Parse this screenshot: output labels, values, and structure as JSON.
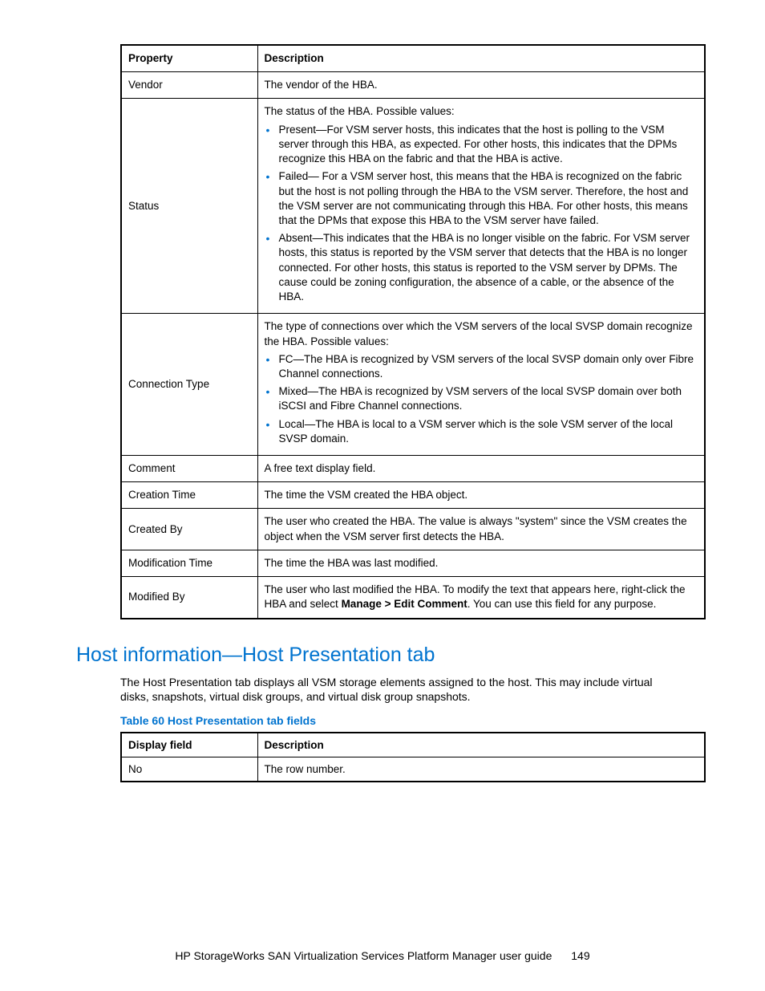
{
  "table1": {
    "headers": [
      "Property",
      "Description"
    ],
    "rows": [
      {
        "prop": "Vendor",
        "desc": "The vendor of the HBA."
      },
      {
        "prop": "Status",
        "intro": "The status of the HBA. Possible values:",
        "bullets": [
          "Present—For VSM server hosts, this indicates that the host is polling to the VSM server through this HBA, as expected. For other hosts, this indicates that the DPMs recognize this HBA on the fabric and that the HBA is active.",
          "Failed— For a VSM server host, this means that the HBA is recognized on the fabric but the host is not polling through the HBA to the VSM server. Therefore, the host and the VSM server are not communicating through this HBA. For other hosts, this means that the DPMs that expose this HBA to the VSM server have failed.",
          "Absent—This indicates that the HBA is no longer visible on the fabric. For VSM server hosts, this status is reported by the VSM server that detects that the HBA is no longer connected. For other hosts, this status is reported to the VSM server by DPMs. The cause could be zoning configuration, the absence of a cable, or the absence of the HBA."
        ]
      },
      {
        "prop": "Connection Type",
        "intro": "The type of connections over which the VSM servers of the local SVSP domain recognize the HBA. Possible values:",
        "bullets": [
          "FC—The HBA is recognized by VSM servers of the local SVSP domain only over Fibre Channel connections.",
          "Mixed—The HBA is recognized by VSM servers of the local SVSP domain over both iSCSI and Fibre Channel connections.",
          "Local—The HBA is local to a VSM server which is the sole VSM server of the local SVSP domain."
        ]
      },
      {
        "prop": "Comment",
        "desc": "A free text display field."
      },
      {
        "prop": "Creation Time",
        "desc": "The time the VSM created the HBA object."
      },
      {
        "prop": "Created By",
        "desc": "The user who created the HBA. The value is always \"system\" since the VSM creates the object when the VSM server first detects the HBA."
      },
      {
        "prop": "Modification Time",
        "desc": "The time the HBA was last modified."
      },
      {
        "prop": "Modified By",
        "desc_pre": "The user who last modified the HBA. To modify the text that appears here, right-click the HBA and select ",
        "desc_bold": "Manage > Edit Comment",
        "desc_post": ". You can use this field for any purpose."
      }
    ]
  },
  "section_heading": "Host information—Host Presentation tab",
  "section_body": "The Host Presentation tab displays all VSM storage elements assigned to the host. This may include virtual disks, snapshots, virtual disk groups, and virtual disk group snapshots.",
  "table2_caption": "Table 60 Host Presentation tab fields",
  "table2": {
    "headers": [
      "Display field",
      "Description"
    ],
    "rows": [
      {
        "field": "No",
        "desc": "The row number."
      }
    ]
  },
  "footer_text": "HP StorageWorks SAN Virtualization Services Platform Manager user guide",
  "footer_page": "149"
}
